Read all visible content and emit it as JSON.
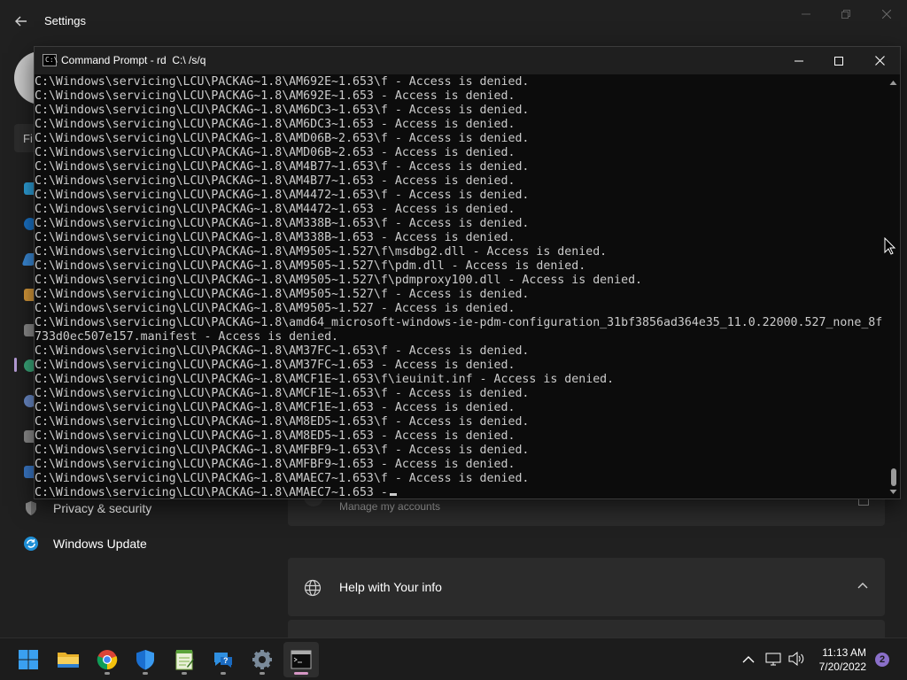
{
  "settings": {
    "title": "Settings",
    "search_partial": "Fi",
    "nav_bottom": [
      {
        "label": "Privacy & security",
        "icon": "shield-icon"
      },
      {
        "label": "Windows Update",
        "icon": "windows-update-icon"
      }
    ],
    "accounts_card": {
      "subtitle": "Manage my accounts"
    },
    "help_card": {
      "title": "Help with Your info"
    }
  },
  "cmd": {
    "title": "Command Prompt - rd  C:\\ /s/q",
    "lines": [
      "C:\\Windows\\servicing\\LCU\\PACKAG~1.8\\AM692E~1.653\\f - Access is denied.",
      "C:\\Windows\\servicing\\LCU\\PACKAG~1.8\\AM692E~1.653 - Access is denied.",
      "C:\\Windows\\servicing\\LCU\\PACKAG~1.8\\AM6DC3~1.653\\f - Access is denied.",
      "C:\\Windows\\servicing\\LCU\\PACKAG~1.8\\AM6DC3~1.653 - Access is denied.",
      "C:\\Windows\\servicing\\LCU\\PACKAG~1.8\\AMD06B~2.653\\f - Access is denied.",
      "C:\\Windows\\servicing\\LCU\\PACKAG~1.8\\AMD06B~2.653 - Access is denied.",
      "C:\\Windows\\servicing\\LCU\\PACKAG~1.8\\AM4B77~1.653\\f - Access is denied.",
      "C:\\Windows\\servicing\\LCU\\PACKAG~1.8\\AM4B77~1.653 - Access is denied.",
      "C:\\Windows\\servicing\\LCU\\PACKAG~1.8\\AM4472~1.653\\f - Access is denied.",
      "C:\\Windows\\servicing\\LCU\\PACKAG~1.8\\AM4472~1.653 - Access is denied.",
      "C:\\Windows\\servicing\\LCU\\PACKAG~1.8\\AM338B~1.653\\f - Access is denied.",
      "C:\\Windows\\servicing\\LCU\\PACKAG~1.8\\AM338B~1.653 - Access is denied.",
      "C:\\Windows\\servicing\\LCU\\PACKAG~1.8\\AM9505~1.527\\f\\msdbg2.dll - Access is denied.",
      "C:\\Windows\\servicing\\LCU\\PACKAG~1.8\\AM9505~1.527\\f\\pdm.dll - Access is denied.",
      "C:\\Windows\\servicing\\LCU\\PACKAG~1.8\\AM9505~1.527\\f\\pdmproxy100.dll - Access is denied.",
      "C:\\Windows\\servicing\\LCU\\PACKAG~1.8\\AM9505~1.527\\f - Access is denied.",
      "C:\\Windows\\servicing\\LCU\\PACKAG~1.8\\AM9505~1.527 - Access is denied.",
      "C:\\Windows\\servicing\\LCU\\PACKAG~1.8\\amd64_microsoft-windows-ie-pdm-configuration_31bf3856ad364e35_11.0.22000.527_none_8f",
      "733d0ec507e157.manifest - Access is denied.",
      "C:\\Windows\\servicing\\LCU\\PACKAG~1.8\\AM37FC~1.653\\f - Access is denied.",
      "C:\\Windows\\servicing\\LCU\\PACKAG~1.8\\AM37FC~1.653 - Access is denied.",
      "C:\\Windows\\servicing\\LCU\\PACKAG~1.8\\AMCF1E~1.653\\f\\ieuinit.inf - Access is denied.",
      "C:\\Windows\\servicing\\LCU\\PACKAG~1.8\\AMCF1E~1.653\\f - Access is denied.",
      "C:\\Windows\\servicing\\LCU\\PACKAG~1.8\\AMCF1E~1.653 - Access is denied.",
      "C:\\Windows\\servicing\\LCU\\PACKAG~1.8\\AM8ED5~1.653\\f - Access is denied.",
      "C:\\Windows\\servicing\\LCU\\PACKAG~1.8\\AM8ED5~1.653 - Access is denied.",
      "C:\\Windows\\servicing\\LCU\\PACKAG~1.8\\AMFBF9~1.653\\f - Access is denied.",
      "C:\\Windows\\servicing\\LCU\\PACKAG~1.8\\AMFBF9~1.653 - Access is denied.",
      "C:\\Windows\\servicing\\LCU\\PACKAG~1.8\\AMAEC7~1.653\\f - Access is denied."
    ],
    "current_line": "C:\\Windows\\servicing\\LCU\\PACKAG~1.8\\AMAEC7~1.653 -"
  },
  "taskbar": {
    "apps": [
      {
        "name": "start",
        "icon": "windows-start-icon"
      },
      {
        "name": "file-explorer",
        "icon": "folder-icon"
      },
      {
        "name": "chrome",
        "icon": "chrome-icon"
      },
      {
        "name": "windows-security",
        "icon": "shield-icon"
      },
      {
        "name": "notepad",
        "icon": "notepad-icon"
      },
      {
        "name": "get-help",
        "icon": "help-icon"
      },
      {
        "name": "settings",
        "icon": "gear-icon"
      },
      {
        "name": "command-prompt",
        "icon": "terminal-icon"
      }
    ],
    "time": "11:13 AM",
    "date": "7/20/2022",
    "notification_count": "2"
  }
}
